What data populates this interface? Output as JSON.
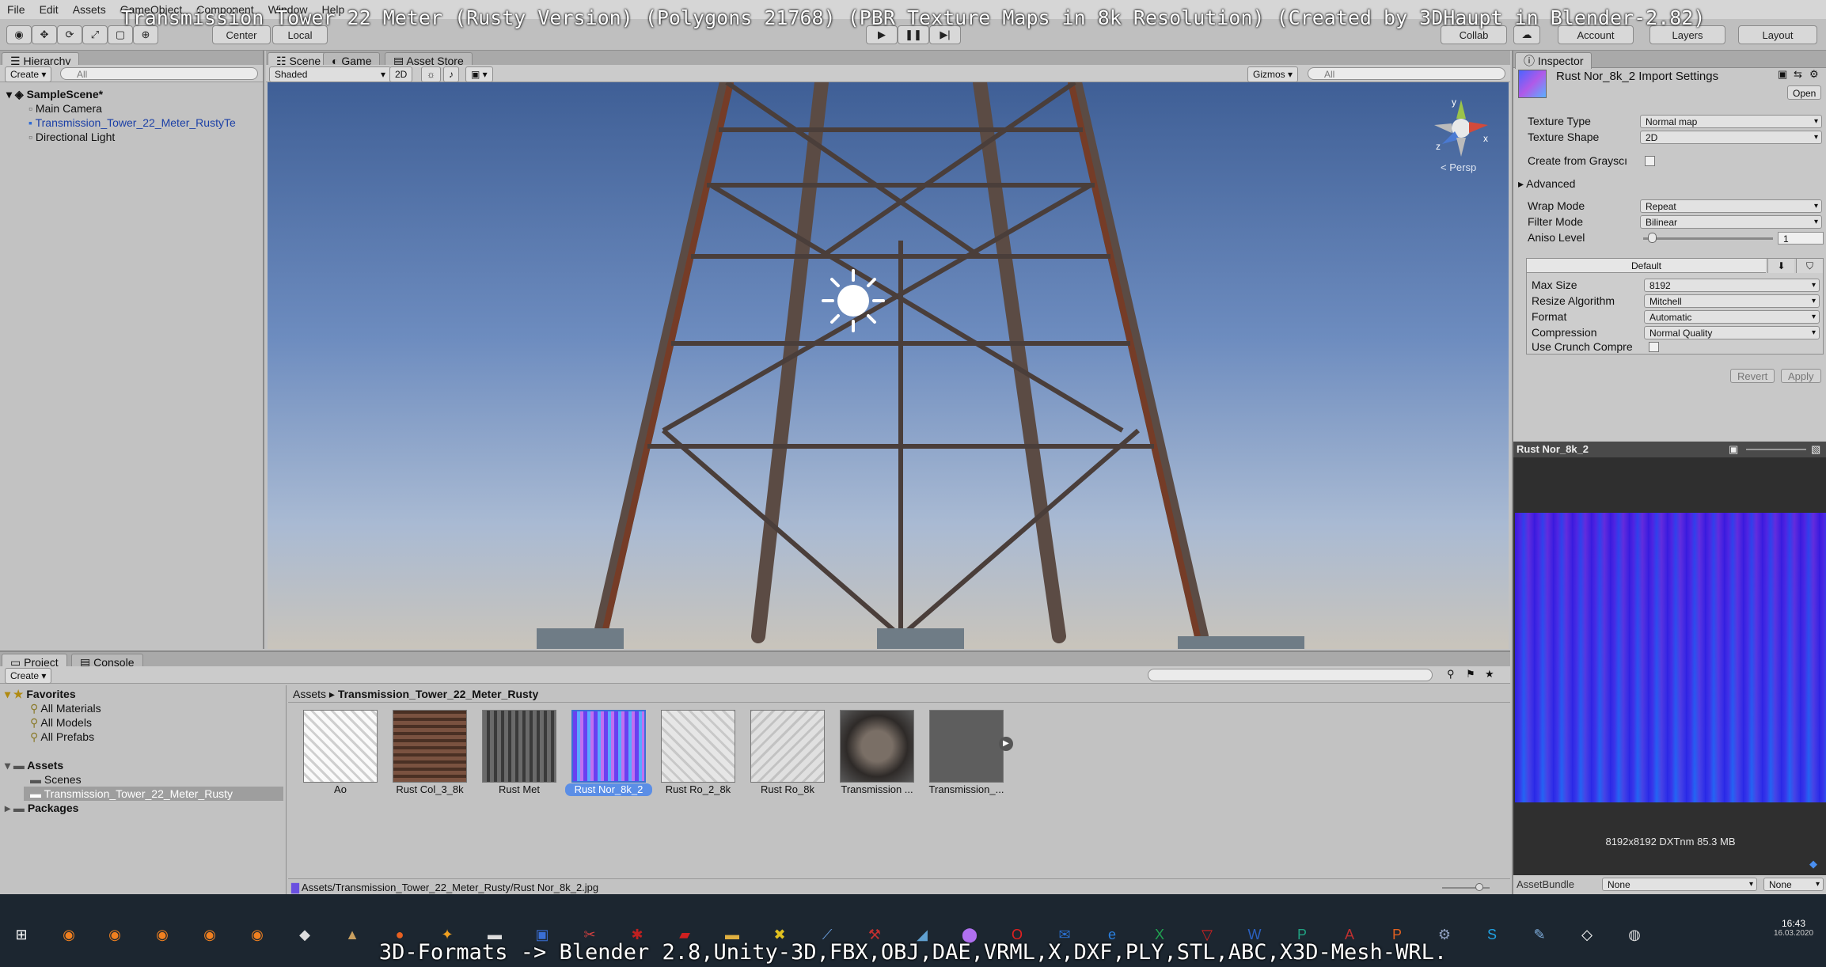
{
  "overlay": {
    "title": "Transmission Tower 22 Meter (Rusty Version) (Polygons 21768) (PBR Texture Maps in 8k Resolution) (Created by 3DHaupt in Blender-2.82)",
    "footer": "3D-Formats -> Blender 2.8,Unity-3D,FBX,OBJ,DAE,VRML,X,DXF,PLY,STL,ABC,X3D-Mesh-WRL."
  },
  "menu": [
    "File",
    "Edit",
    "Assets",
    "GameObject",
    "Component",
    "Window",
    "Help"
  ],
  "toolbar": {
    "pivot": "Center",
    "space": "Local",
    "collab": "Collab",
    "account": "Account",
    "layers": "Layers",
    "layout": "Layout"
  },
  "hierarchy": {
    "tab": "Hierarchy",
    "create": "Create",
    "search_placeholder": "All",
    "scene": "SampleScene*",
    "items": [
      "Main Camera",
      "Transmission_Tower_22_Meter_RustyTe",
      "Directional Light"
    ]
  },
  "scene_view": {
    "tabs": [
      "Scene",
      "Game",
      "Asset Store"
    ],
    "shading": "Shaded",
    "mode_2d": "2D",
    "gizmos": "Gizmos",
    "search_placeholder": "All",
    "persp": "Persp",
    "gizmo_axes": {
      "y": "y",
      "z": "z",
      "x": "x"
    }
  },
  "project": {
    "tabs": [
      "Project",
      "Console"
    ],
    "create": "Create",
    "favorites_label": "Favorites",
    "favorites": [
      "All Materials",
      "All Models",
      "All Prefabs"
    ],
    "assets_label": "Assets",
    "asset_folders": [
      "Scenes",
      "Transmission_Tower_22_Meter_Rusty"
    ],
    "packages_label": "Packages",
    "breadcrumb": [
      "Assets",
      "Transmission_Tower_22_Meter_Rusty"
    ],
    "thumbnails": [
      {
        "label": "Ao",
        "color": "#e8e8e8"
      },
      {
        "label": "Rust Col_3_8k",
        "color": "#6b4a3a"
      },
      {
        "label": "Rust Met",
        "color": "#5a5a5a"
      },
      {
        "label": "Rust Nor_8k_2",
        "color": "#7c5cf0",
        "selected": true
      },
      {
        "label": "Rust Ro_2_8k",
        "color": "#d8d8d8"
      },
      {
        "label": "Rust Ro_8k",
        "color": "#d2d2d2"
      },
      {
        "label": "Transmission ...",
        "color": "#3d3a38"
      },
      {
        "label": "Transmission_...",
        "color": "#5a5a5a"
      }
    ],
    "status_path": "Assets/Transmission_Tower_22_Meter_Rusty/Rust Nor_8k_2.jpg"
  },
  "inspector": {
    "tab": "Inspector",
    "title": "Rust Nor_8k_2 Import Settings",
    "open": "Open",
    "fields": [
      {
        "label": "Texture Type",
        "value": "Normal map"
      },
      {
        "label": "Texture Shape",
        "value": "2D"
      }
    ],
    "create_from_grayscale": "Create from Grayscı",
    "advanced": "Advanced",
    "fields2": [
      {
        "label": "Wrap Mode",
        "value": "Repeat"
      },
      {
        "label": "Filter Mode",
        "value": "Bilinear"
      }
    ],
    "aniso_label": "Aniso Level",
    "aniso_value": "1",
    "platform_tab": "Default",
    "platform_fields": [
      {
        "label": "Max Size",
        "value": "8192"
      },
      {
        "label": "Resize Algorithm",
        "value": "Mitchell"
      },
      {
        "label": "Format",
        "value": "Automatic"
      },
      {
        "label": "Compression",
        "value": "Normal Quality"
      }
    ],
    "crunch_label": "Use Crunch Compre",
    "revert": "Revert",
    "apply": "Apply"
  },
  "preview": {
    "title": "Rust Nor_8k_2",
    "info": "8192x8192  DXTnm   85.3 MB",
    "assetbundle_label": "AssetBundle",
    "assetbundle_value": "None",
    "variant_value": "None"
  },
  "taskbar": {
    "time": "16:43",
    "date": "16.03.2020"
  }
}
